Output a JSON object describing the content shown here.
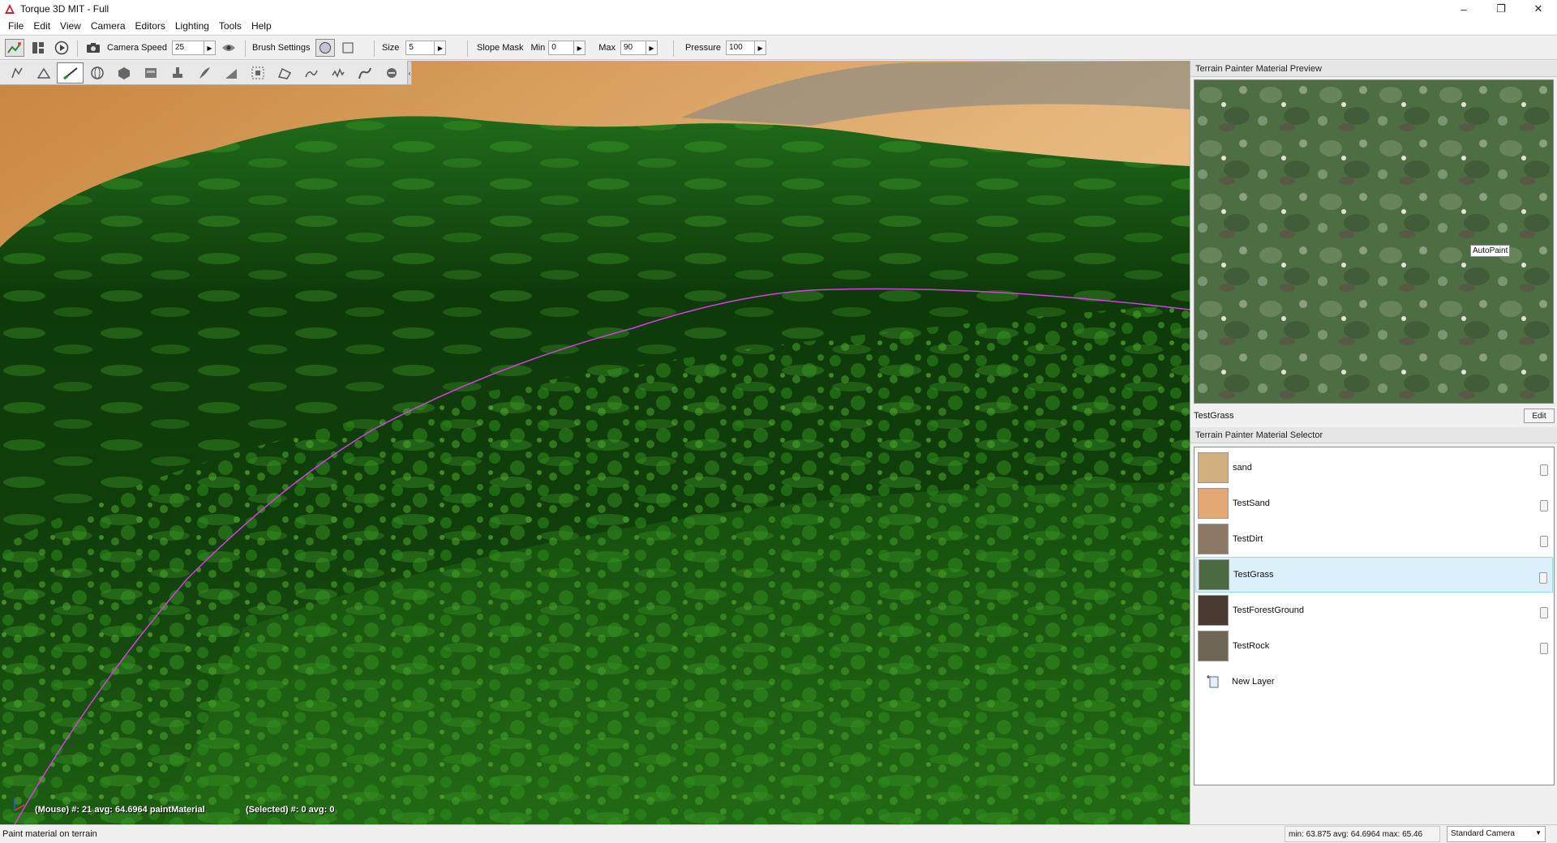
{
  "window": {
    "title": "Torque 3D MIT - Full",
    "controls": [
      "–",
      "❐",
      "✕"
    ]
  },
  "menu": [
    "File",
    "Edit",
    "View",
    "Camera",
    "Editors",
    "Lighting",
    "Tools",
    "Help"
  ],
  "toolbar": {
    "camera_speed_label": "Camera Speed",
    "camera_speed_value": "25",
    "brush_settings_label": "Brush Settings",
    "size_label": "Size",
    "size_value": "5",
    "slope_mask_label": "Slope Mask",
    "min_label": "Min",
    "min_value": "0",
    "max_label": "Max",
    "max_value": "90",
    "pressure_label": "Pressure",
    "pressure_value": "100"
  },
  "viewport": {
    "mouse_stats": "(Mouse) #: 21  avg: 64.6964 paintMaterial",
    "selected_stats": "(Selected) #: 0  avg: 0",
    "palette_icons": [
      "select-arrow-icon",
      "raise-height-icon",
      "paint-material-icon",
      "sphere-icon",
      "cube-icon",
      "terrain-block-icon",
      "stamp-icon",
      "feather-icon",
      "slope-icon",
      "scale-icon",
      "flatten-icon",
      "smooth-icon",
      "noise-icon",
      "erosion-icon",
      "clear-icon"
    ]
  },
  "preview_panel": {
    "title": "Terrain Painter Material Preview",
    "autopaint_label": "AutoPaint",
    "material_name": "TestGrass",
    "edit_label": "Edit"
  },
  "selector_panel": {
    "title": "Terrain Painter Material Selector",
    "materials": [
      {
        "name": "sand",
        "color": "#d2b07e"
      },
      {
        "name": "TestSand",
        "color": "#e3a874"
      },
      {
        "name": "TestDirt",
        "color": "#8c7865"
      },
      {
        "name": "TestGrass",
        "color": "#4c6a42"
      },
      {
        "name": "TestForestGround",
        "color": "#4a3a31"
      },
      {
        "name": "TestRock",
        "color": "#6f6656"
      }
    ],
    "selected_index": 3,
    "new_layer_label": "New Layer"
  },
  "statusbar": {
    "message": "Paint material on terrain",
    "stats": "min: 63.875  avg: 64.6964  max: 65.46",
    "camera_mode": "Standard Camera"
  },
  "colors": {
    "selection": "#dcf0fb",
    "brush_line": "#d63fe0",
    "grass_dark": "#0b2407",
    "grass_light": "#2f7f1a",
    "sand": "#d8a86c"
  }
}
